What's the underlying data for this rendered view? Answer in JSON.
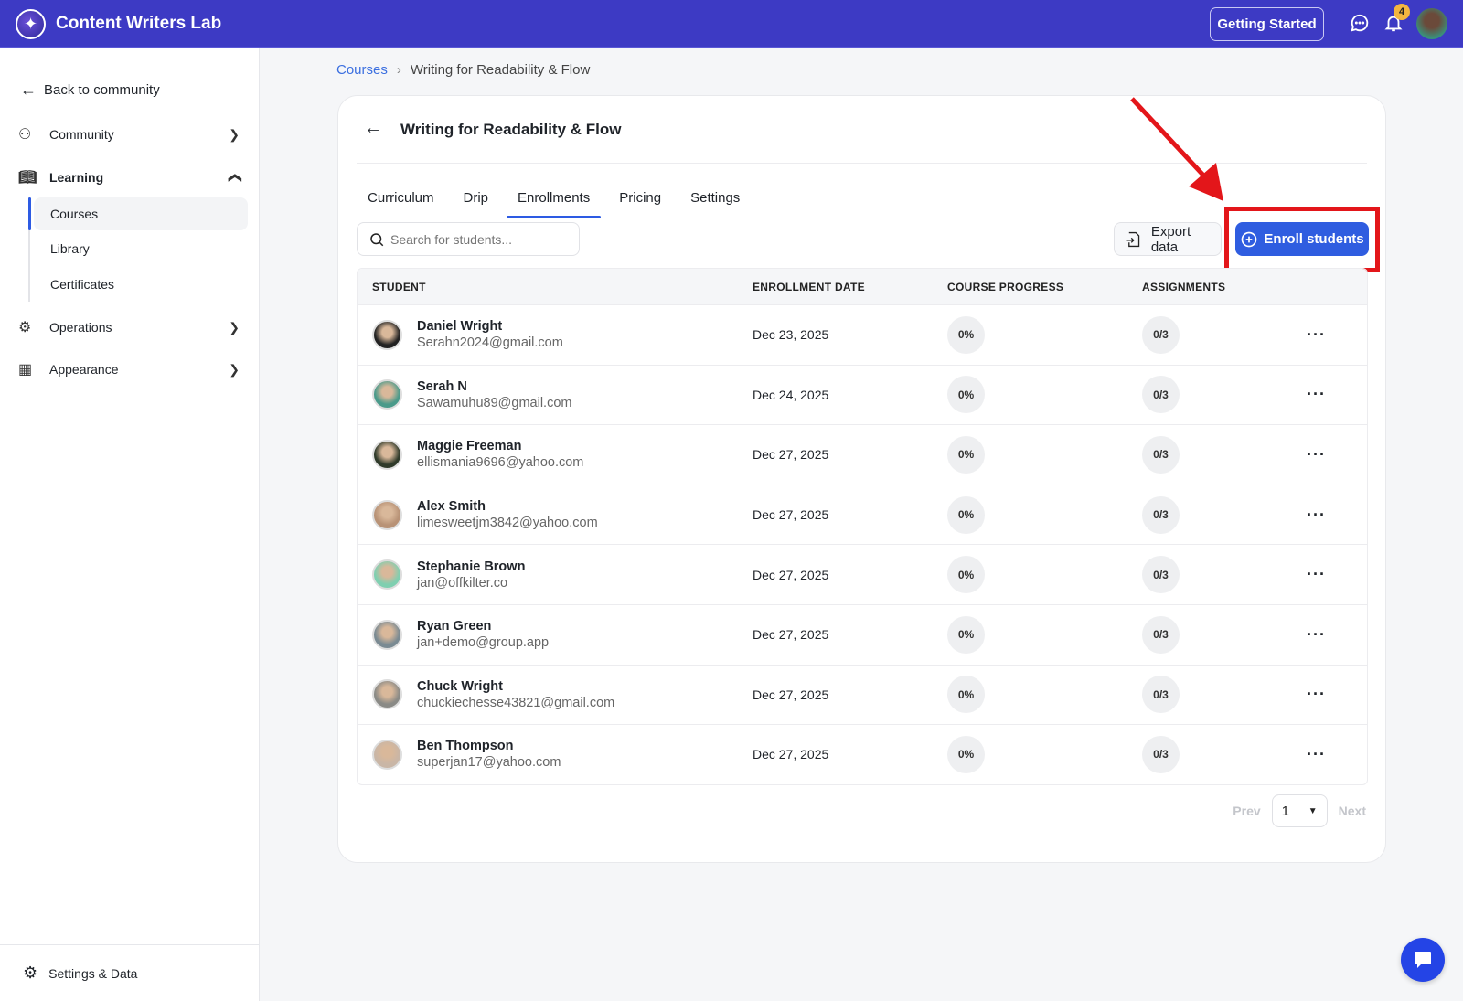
{
  "app": {
    "title": "Content Writers Lab",
    "getting_started": "Getting Started",
    "notification_count": "4"
  },
  "sidebar": {
    "back": "Back to community",
    "items": [
      {
        "label": "Community"
      },
      {
        "label": "Learning"
      },
      {
        "label": "Operations"
      },
      {
        "label": "Appearance"
      }
    ],
    "sub_items": [
      {
        "label": "Courses"
      },
      {
        "label": "Library"
      },
      {
        "label": "Certificates"
      }
    ],
    "footer": "Settings & Data"
  },
  "breadcrumb": {
    "root": "Courses",
    "current": "Writing for Readability & Flow"
  },
  "course": {
    "title": "Writing for Readability & Flow",
    "tabs": [
      {
        "label": "Curriculum"
      },
      {
        "label": "Drip"
      },
      {
        "label": "Enrollments"
      },
      {
        "label": "Pricing"
      },
      {
        "label": "Settings"
      }
    ],
    "search_placeholder": "Search for students...",
    "export_label": "Export data",
    "enroll_label": "Enroll students"
  },
  "table": {
    "headers": [
      "STUDENT",
      "ENROLLMENT DATE",
      "COURSE PROGRESS",
      "ASSIGNMENTS"
    ],
    "rows": [
      {
        "name": "Daniel Wright",
        "email": "Serahn2024@gmail.com",
        "date": "Dec 23, 2025",
        "progress": "0%",
        "assignments": "0/3",
        "color": "#222222"
      },
      {
        "name": "Serah N",
        "email": "Sawamuhu89@gmail.com",
        "date": "Dec 24, 2025",
        "progress": "0%",
        "assignments": "0/3",
        "color": "#4a9a8a"
      },
      {
        "name": "Maggie Freeman",
        "email": "ellismania9696@yahoo.com",
        "date": "Dec 27, 2025",
        "progress": "0%",
        "assignments": "0/3",
        "color": "#2f3a2a"
      },
      {
        "name": "Alex Smith",
        "email": "limesweetjm3842@yahoo.com",
        "date": "Dec 27, 2025",
        "progress": "0%",
        "assignments": "0/3",
        "color": "#b89276"
      },
      {
        "name": "Stephanie Brown",
        "email": "jan@offkilter.co",
        "date": "Dec 27, 2025",
        "progress": "0%",
        "assignments": "0/3",
        "color": "#7fcfb0"
      },
      {
        "name": "Ryan Green",
        "email": "jan+demo@group.app",
        "date": "Dec 27, 2025",
        "progress": "0%",
        "assignments": "0/3",
        "color": "#7a8a92"
      },
      {
        "name": "Chuck Wright",
        "email": "chuckiechesse43821@gmail.com",
        "date": "Dec 27, 2025",
        "progress": "0%",
        "assignments": "0/3",
        "color": "#8a8a86"
      },
      {
        "name": "Ben Thompson",
        "email": "superjan17@yahoo.com",
        "date": "Dec 27, 2025",
        "progress": "0%",
        "assignments": "0/3",
        "color": "#c9b6a6"
      }
    ]
  },
  "pagination": {
    "prev": "Prev",
    "page": "1",
    "next": "Next"
  }
}
